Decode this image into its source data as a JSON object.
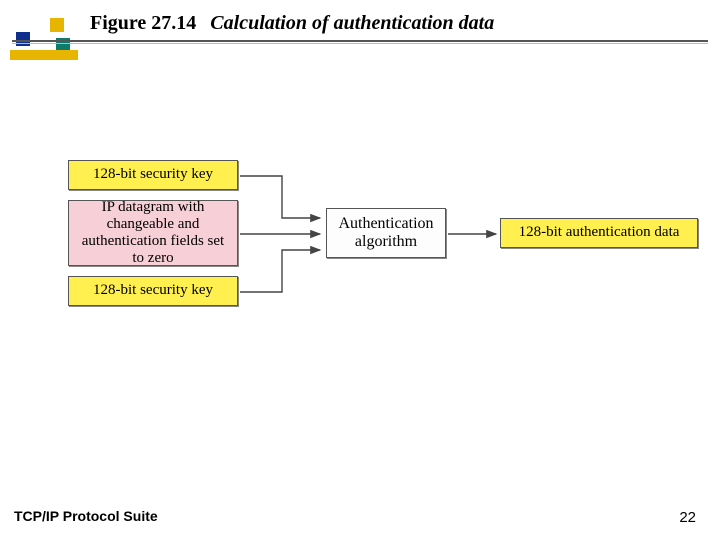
{
  "header": {
    "figure_label": "Figure 27.14",
    "figure_title": "Calculation of authentication data"
  },
  "diagram": {
    "inputs": {
      "key_top": "128-bit security key",
      "datagram": "IP datagram with changeable and authentication fields set to zero",
      "key_bottom": "128-bit security key"
    },
    "process": "Authentication algorithm",
    "output": "128-bit authentication data"
  },
  "footer": {
    "source": "TCP/IP Protocol Suite",
    "page": "22"
  }
}
